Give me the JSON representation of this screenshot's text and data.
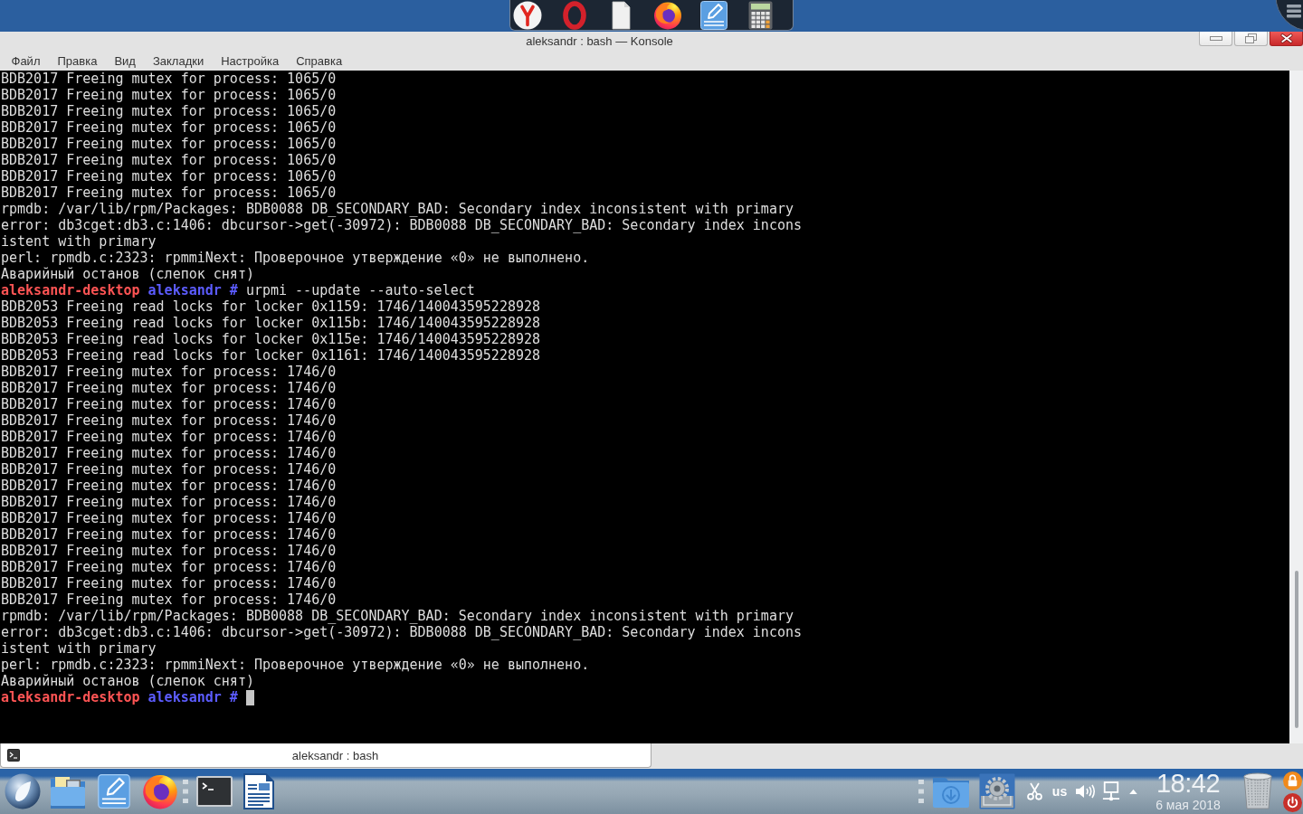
{
  "window": {
    "title": "aleksandr : bash — Konsole"
  },
  "menu": [
    "Файл",
    "Правка",
    "Вид",
    "Закладки",
    "Настройка",
    "Справка"
  ],
  "terminal": {
    "cursor": true,
    "lines": [
      {
        "kind": "output",
        "text": "BDB2017 Freeing mutex for process: 1065/0"
      },
      {
        "kind": "output",
        "text": "BDB2017 Freeing mutex for process: 1065/0"
      },
      {
        "kind": "output",
        "text": "BDB2017 Freeing mutex for process: 1065/0"
      },
      {
        "kind": "output",
        "text": "BDB2017 Freeing mutex for process: 1065/0"
      },
      {
        "kind": "output",
        "text": "BDB2017 Freeing mutex for process: 1065/0"
      },
      {
        "kind": "output",
        "text": "BDB2017 Freeing mutex for process: 1065/0"
      },
      {
        "kind": "output",
        "text": "BDB2017 Freeing mutex for process: 1065/0"
      },
      {
        "kind": "output",
        "text": "BDB2017 Freeing mutex for process: 1065/0"
      },
      {
        "kind": "output",
        "text": "rpmdb: /var/lib/rpm/Packages: BDB0088 DB_SECONDARY_BAD: Secondary index inconsistent with primary"
      },
      {
        "kind": "output",
        "text": "error: db3cget:db3.c:1406: dbcursor->get(-30972): BDB0088 DB_SECONDARY_BAD: Secondary index incons"
      },
      {
        "kind": "output",
        "text": "istent with primary"
      },
      {
        "kind": "output",
        "text": "perl: rpmdb.c:2323: rpmmiNext: Проверочное утверждение «0» не выполнено."
      },
      {
        "kind": "output",
        "text": "Аварийный останов (слепок снят)"
      },
      {
        "kind": "prompt",
        "host": "aleksandr-desktop",
        "directory": "aleksandr",
        "symbol": "#",
        "command": "urpmi --update --auto-select"
      },
      {
        "kind": "output",
        "text": "BDB2053 Freeing read locks for locker 0x1159: 1746/140043595228928"
      },
      {
        "kind": "output",
        "text": "BDB2053 Freeing read locks for locker 0x115b: 1746/140043595228928"
      },
      {
        "kind": "output",
        "text": "BDB2053 Freeing read locks for locker 0x115e: 1746/140043595228928"
      },
      {
        "kind": "output",
        "text": "BDB2053 Freeing read locks for locker 0x1161: 1746/140043595228928"
      },
      {
        "kind": "output",
        "text": "BDB2017 Freeing mutex for process: 1746/0"
      },
      {
        "kind": "output",
        "text": "BDB2017 Freeing mutex for process: 1746/0"
      },
      {
        "kind": "output",
        "text": "BDB2017 Freeing mutex for process: 1746/0"
      },
      {
        "kind": "output",
        "text": "BDB2017 Freeing mutex for process: 1746/0"
      },
      {
        "kind": "output",
        "text": "BDB2017 Freeing mutex for process: 1746/0"
      },
      {
        "kind": "output",
        "text": "BDB2017 Freeing mutex for process: 1746/0"
      },
      {
        "kind": "output",
        "text": "BDB2017 Freeing mutex for process: 1746/0"
      },
      {
        "kind": "output",
        "text": "BDB2017 Freeing mutex for process: 1746/0"
      },
      {
        "kind": "output",
        "text": "BDB2017 Freeing mutex for process: 1746/0"
      },
      {
        "kind": "output",
        "text": "BDB2017 Freeing mutex for process: 1746/0"
      },
      {
        "kind": "output",
        "text": "BDB2017 Freeing mutex for process: 1746/0"
      },
      {
        "kind": "output",
        "text": "BDB2017 Freeing mutex for process: 1746/0"
      },
      {
        "kind": "output",
        "text": "BDB2017 Freeing mutex for process: 1746/0"
      },
      {
        "kind": "output",
        "text": "BDB2017 Freeing mutex for process: 1746/0"
      },
      {
        "kind": "output",
        "text": "BDB2017 Freeing mutex for process: 1746/0"
      },
      {
        "kind": "output",
        "text": "rpmdb: /var/lib/rpm/Packages: BDB0088 DB_SECONDARY_BAD: Secondary index inconsistent with primary"
      },
      {
        "kind": "output",
        "text": "error: db3cget:db3.c:1406: dbcursor->get(-30972): BDB0088 DB_SECONDARY_BAD: Secondary index incons"
      },
      {
        "kind": "output",
        "text": "istent with primary"
      },
      {
        "kind": "output",
        "text": "perl: rpmdb.c:2323: rpmmiNext: Проверочное утверждение «0» не выполнено."
      },
      {
        "kind": "output",
        "text": "Аварийный останов (слепок снят)"
      },
      {
        "kind": "prompt",
        "host": "aleksandr-desktop",
        "directory": "aleksandr",
        "symbol": "#"
      }
    ]
  },
  "tabs": [
    {
      "label": "aleksandr : bash",
      "selected": true
    }
  ],
  "taskbar": {
    "keyboard_layout": "us",
    "clock": {
      "time": "18:42",
      "date": "6 мая 2018"
    }
  }
}
